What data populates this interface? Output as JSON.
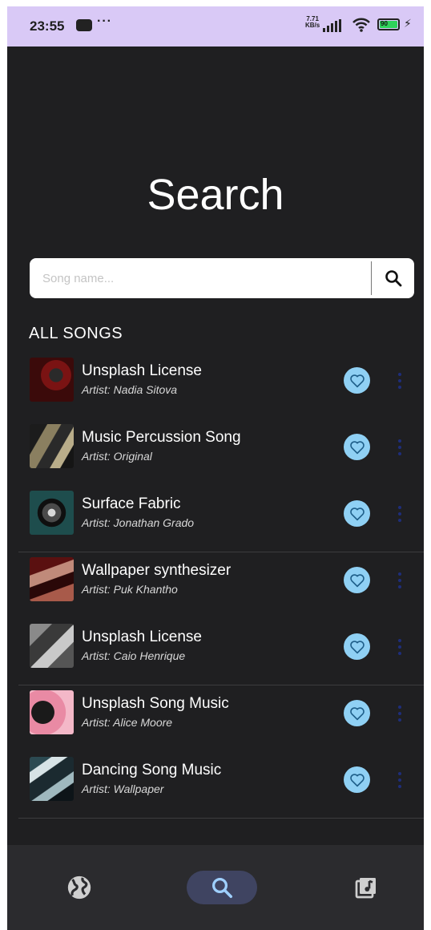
{
  "status_bar": {
    "time": "23:55",
    "speed_top": "7.71",
    "speed_bottom": "KB/s",
    "battery": "90"
  },
  "page": {
    "title": "Search"
  },
  "search": {
    "placeholder": "Song name..."
  },
  "section": {
    "title": "ALL SONGS"
  },
  "songs": [
    {
      "title": "Unsplash License",
      "artist": "Artist: Nadia Sitova"
    },
    {
      "title": "Music Percussion Song",
      "artist": "Artist: Original"
    },
    {
      "title": "Surface Fabric",
      "artist": "Artist: Jonathan Grado"
    },
    {
      "title": "Wallpaper synthesizer",
      "artist": "Artist: Puk Khantho"
    },
    {
      "title": "Unsplash License",
      "artist": "Artist: Caio Henrique"
    },
    {
      "title": "Unsplash Song Music",
      "artist": "Artist: Alice Moore"
    },
    {
      "title": "Dancing Song Music",
      "artist": "Artist: Wallpaper"
    }
  ],
  "icons": {
    "search": "search-icon",
    "favorite": "heart-icon",
    "more": "more-vertical-icon",
    "explore": "globe-icon",
    "library": "music-library-icon"
  },
  "colors": {
    "background": "#1f1f21",
    "status_bar": "#d9c9f6",
    "favorite": "#8fd0f4",
    "nav_active": "#3f4461"
  }
}
